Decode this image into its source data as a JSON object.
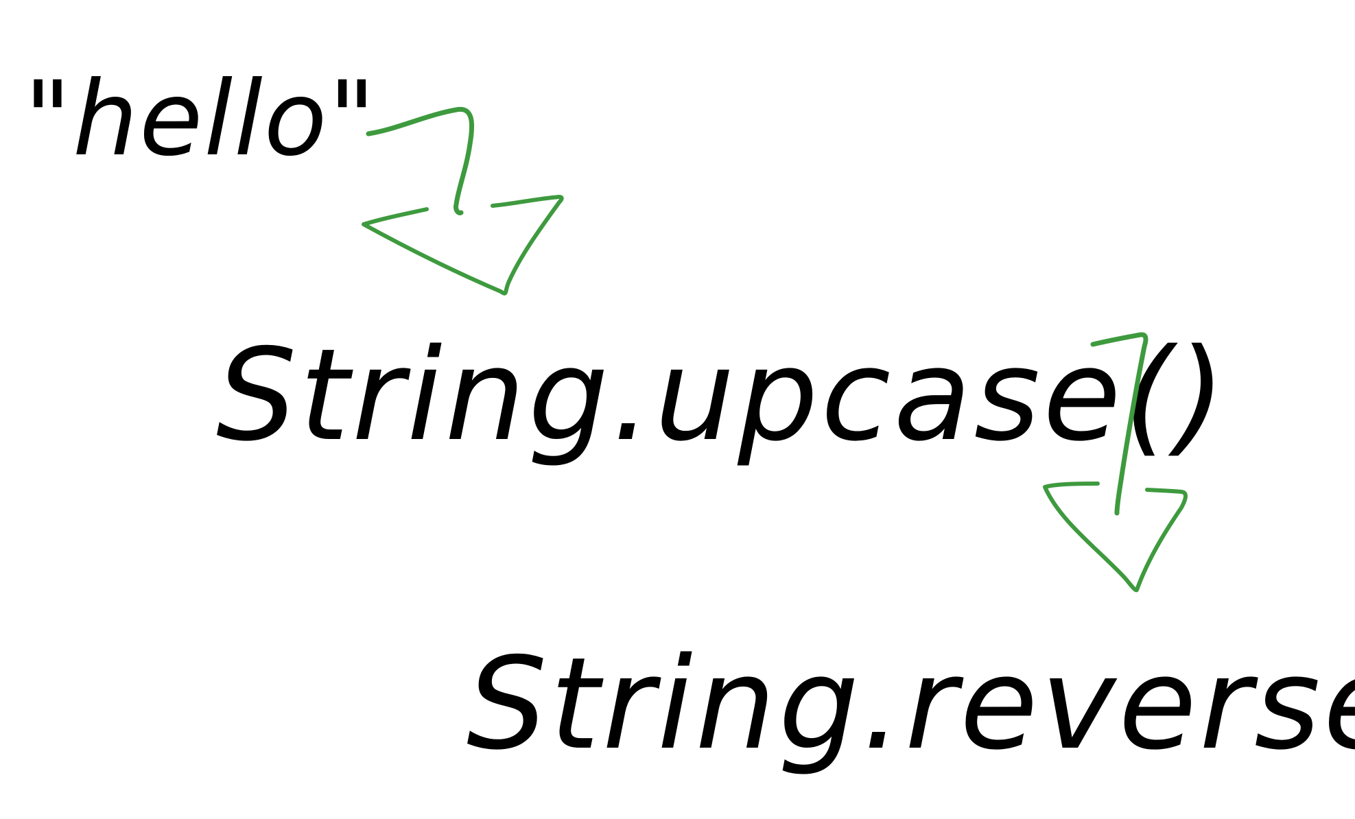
{
  "steps": [
    {
      "label": "\"hello\""
    },
    {
      "label": "String.upcase()"
    },
    {
      "label": "String.reverse()"
    }
  ],
  "colors": {
    "ink": "#000000",
    "arrow": "#3e9a3e",
    "background": "#ffffff"
  },
  "connectors": [
    {
      "from": "\"hello\"",
      "to": "String.upcase()",
      "icon": "curved-down-arrow-icon"
    },
    {
      "from": "String.upcase()",
      "to": "String.reverse()",
      "icon": "curved-down-arrow-icon"
    }
  ]
}
